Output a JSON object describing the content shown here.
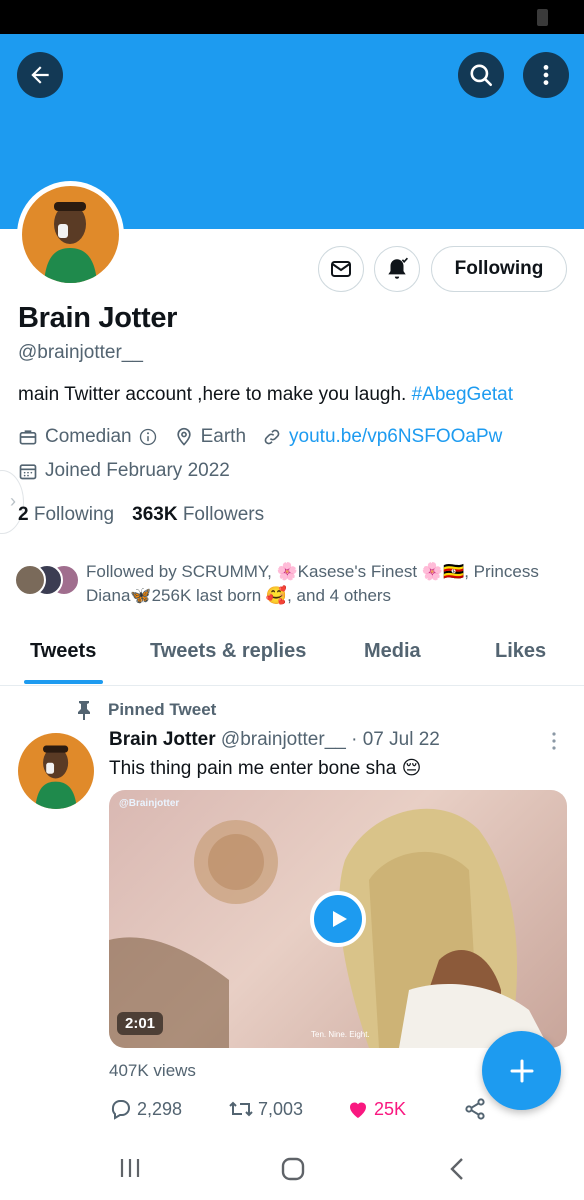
{
  "colors": {
    "accent": "#1d9bf0",
    "like": "#f91880",
    "text": "#0f1419",
    "muted": "#536471"
  },
  "header": {
    "back_icon": "arrow-left-icon",
    "search_icon": "search-icon",
    "more_icon": "more-vertical-icon"
  },
  "profile": {
    "display_name": "Brain Jotter",
    "handle": "@brainjotter__",
    "bio_text": "main Twitter account ,here to make you laugh. ",
    "bio_hashtag": "#AbegGetat",
    "category": "Comedian",
    "location": "Earth",
    "website": "youtu.be/vp6NSFOOaPw",
    "joined": "Joined February 2022",
    "following_count": "2",
    "following_label": "Following",
    "followers_count": "363K",
    "followers_label": "Followers",
    "followed_by_line1": "Followed by SCRUMMY, 🌸Kasese's Finest 🌸🇺🇬, Princess",
    "followed_by_line2": "Diana🦋256K last born 🥰, and 4 others"
  },
  "actions": {
    "following_button": "Following",
    "mail_icon": "mail-icon",
    "bell_icon": "bell-subscribed-icon"
  },
  "tabs": [
    {
      "label": "Tweets",
      "active": true
    },
    {
      "label": "Tweets & replies",
      "active": false
    },
    {
      "label": "Media",
      "active": false
    },
    {
      "label": "Likes",
      "active": false
    }
  ],
  "tweet": {
    "pinned_label": "Pinned Tweet",
    "author": "Brain Jotter",
    "handle": "@brainjotter__",
    "date": " · 07 Jul 22",
    "text": "This thing pain me enter bone sha 😔",
    "media": {
      "watermark": "@Brainjotter",
      "duration": "2:01",
      "caption": "Ten. Nine. Eight."
    },
    "views": "407K views",
    "replies": "2,298",
    "retweets": "7,003",
    "likes": "25K"
  },
  "fab": {
    "icon": "plus-icon"
  },
  "system_nav": {
    "recents_icon": "recents-icon",
    "home_icon": "home-icon",
    "back_icon": "back-chevron-icon"
  }
}
